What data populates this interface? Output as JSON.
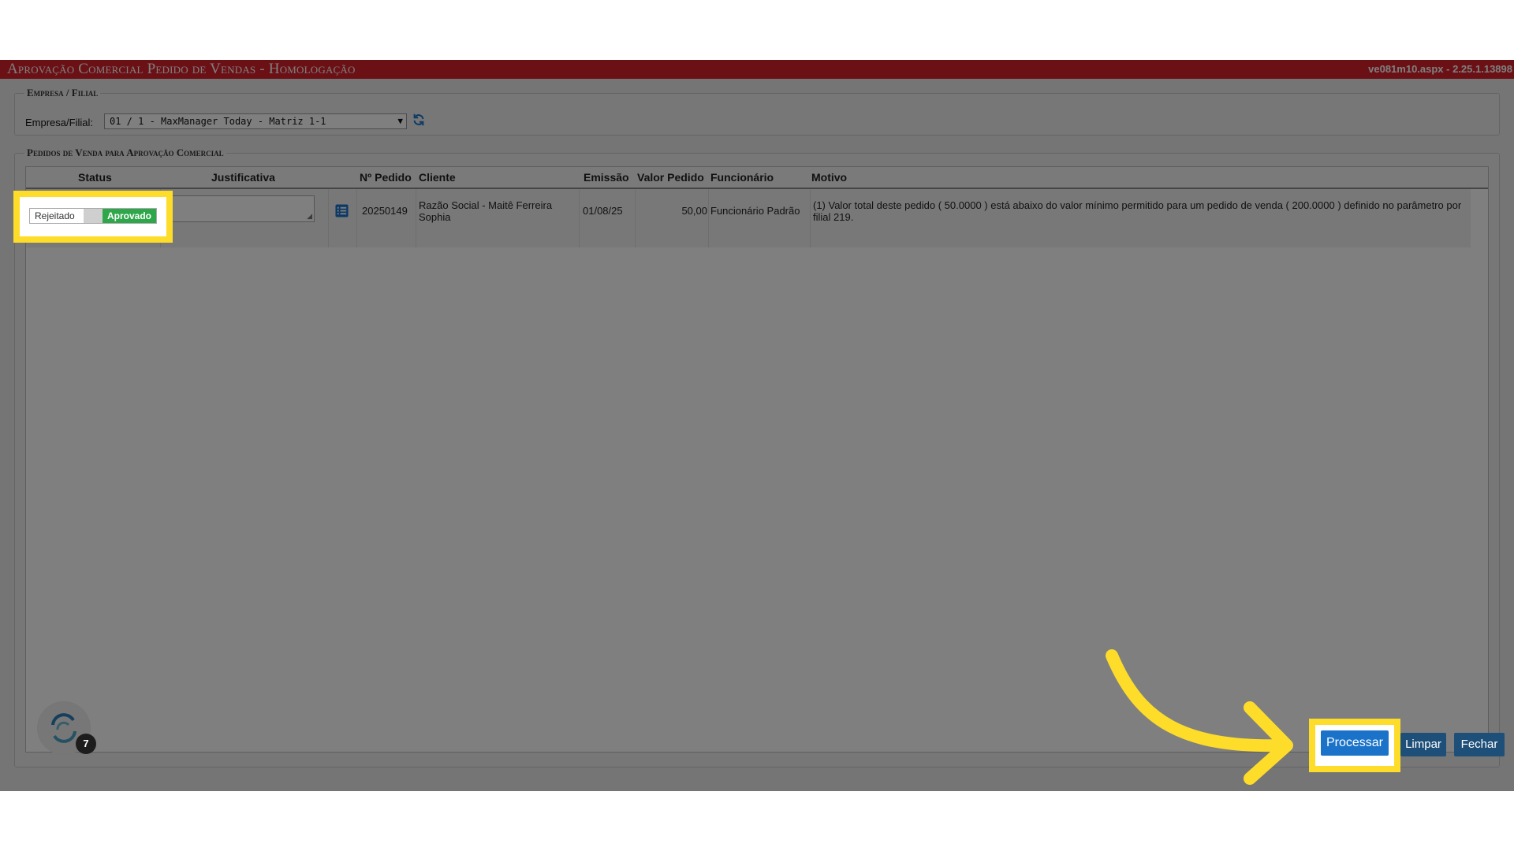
{
  "window": {
    "title": "Aprovação Comercial Pedido de Vendas  - Homologação",
    "version": "ve081m10.aspx - 2.25.1.13898"
  },
  "empresa": {
    "legend": "Empresa / Filial",
    "label": "Empresa/Filial:",
    "selected": "01 / 1 - MaxManager Today - Matriz 1-1"
  },
  "pedidos": {
    "legend": "Pedidos de Venda para Aprovação Comercial",
    "columns": {
      "status": "Status",
      "justificativa": "Justificativa",
      "numero": "Nº Pedido",
      "cliente": "Cliente",
      "emissao": "Emissão",
      "valor": "Valor Pedido",
      "funcionario": "Funcionário",
      "motivo": "Motivo"
    },
    "rows": [
      {
        "status_off": "Rejeitado",
        "status_on": "Aprovado",
        "numero": "20250149",
        "cliente": "Razão Social - Maitê Ferreira Sophia",
        "emissao": "01/08/25",
        "valor": "50,00",
        "funcionario": "Funcionário Padrão",
        "motivo": "(1) Valor total deste pedido ( 50.0000 ) está abaixo do valor mínimo permitido para um pedido de venda ( 200.0000 ) definido no parâmetro por filial 219."
      }
    ]
  },
  "buttons": {
    "processar": "Processar",
    "limpar": "Limpar",
    "fechar": "Fechar"
  },
  "badge_count": "7",
  "colors": {
    "titlebar": "#d6222c",
    "approved": "#2ea74a",
    "highlight": "#fddc2a",
    "primary_button": "#1b73c9"
  }
}
